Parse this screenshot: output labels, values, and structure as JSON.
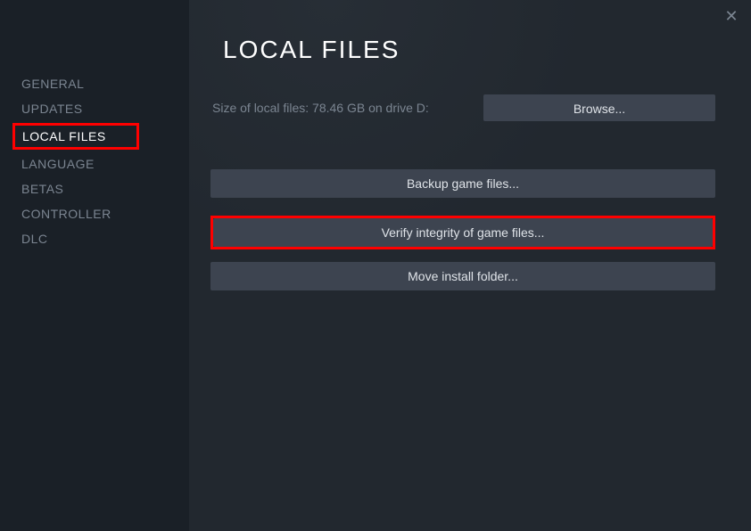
{
  "sidebar": {
    "items": [
      {
        "label": "GENERAL"
      },
      {
        "label": "UPDATES"
      },
      {
        "label": "LOCAL FILES"
      },
      {
        "label": "LANGUAGE"
      },
      {
        "label": "BETAS"
      },
      {
        "label": "CONTROLLER"
      },
      {
        "label": "DLC"
      }
    ],
    "activeIndex": 2
  },
  "main": {
    "title": "LOCAL FILES",
    "sizeInfo": "Size of local files: 78.46 GB on drive D:",
    "browseLabel": "Browse...",
    "backupLabel": "Backup game files...",
    "verifyLabel": "Verify integrity of game files...",
    "moveLabel": "Move install folder..."
  }
}
